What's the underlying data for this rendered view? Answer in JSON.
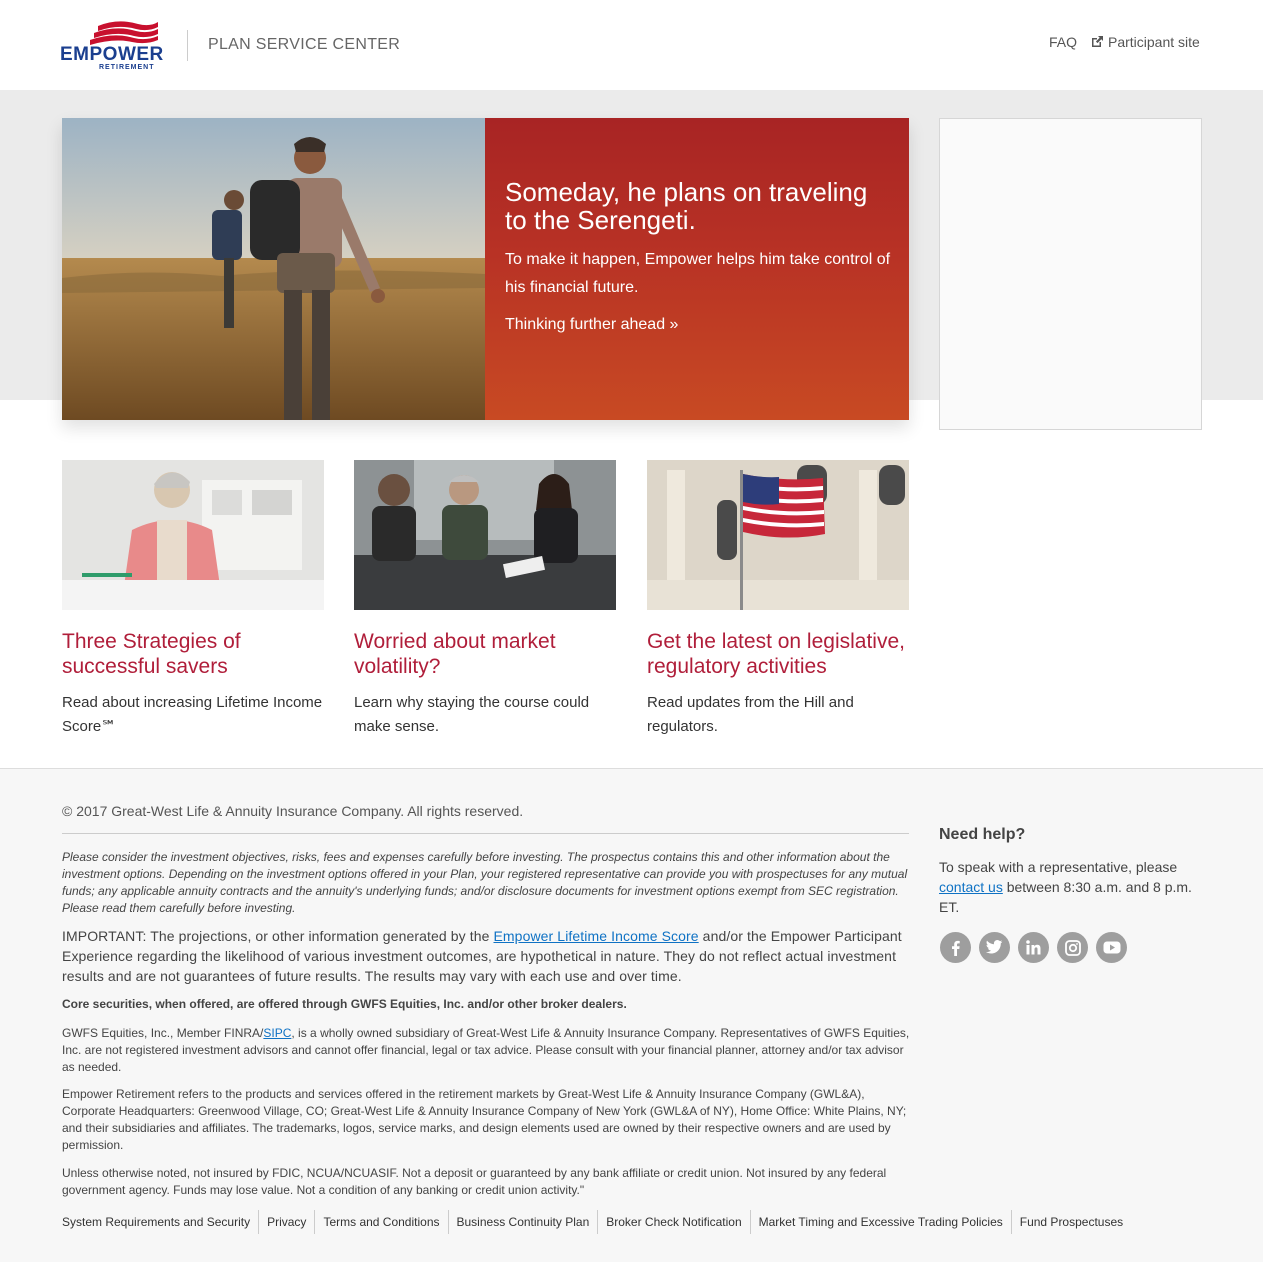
{
  "header": {
    "logo_word": "EMPOWER",
    "logo_sub": "RETIREMENT",
    "plan_title": "PLAN SERVICE CENTER",
    "faq_label": "FAQ",
    "participant_label": "Participant site"
  },
  "hero": {
    "title": "Someday, he plans on traveling to the Serengeti.",
    "text": "To make it happen, Empower helps him take control of his financial future.",
    "link": "Thinking further ahead »"
  },
  "cards": [
    {
      "title": "Three Strategies of successful savers",
      "desc": "Read about increasing Lifetime Income Score℠"
    },
    {
      "title": "Worried about market volatility?",
      "desc": "Learn why staying the course could make sense."
    },
    {
      "title": "Get the latest on legislative, regulatory activities",
      "desc": "Read updates from the Hill and regulators."
    }
  ],
  "footer": {
    "copyright": "© 2017 Great-West Life & Annuity Insurance Company. All rights reserved.",
    "disclaimer_italic": "Please consider the investment objectives, risks, fees and expenses carefully before investing. The prospectus contains this and other information about the investment options. Depending on the investment options offered in your Plan, your registered representative can provide you with prospectuses for any mutual funds; any applicable annuity contracts and the annuity's underlying funds; and/or disclosure documents for investment options exempt from SEC registration. Please read them carefully before investing.",
    "important_pre": "IMPORTANT: The projections, or other information generated by the ",
    "important_link": "Empower Lifetime Income Score",
    "important_post": " and/or the Empower Participant Experience regarding the likelihood of various investment outcomes, are hypothetical in nature. They do not reflect actual investment results and are not guarantees of future results. The results may vary with each use and over time.",
    "core_securities": "Core securities, when offered, are offered through GWFS Equities, Inc. and/or other broker dealers.",
    "gwfs_pre": "GWFS Equities, Inc., Member FINRA/",
    "gwfs_link": "SIPC",
    "gwfs_post": ", is a wholly owned subsidiary of Great-West Life & Annuity Insurance Company. Representatives of GWFS Equities, Inc. are not registered investment advisors and cannot offer financial, legal or tax advice. Please consult with your financial planner, attorney and/or tax advisor as needed.",
    "empower_refers": "Empower Retirement refers to the products and services offered in the retirement markets by Great-West Life & Annuity Insurance Company (GWL&A), Corporate Headquarters: Greenwood Village, CO; Great-West Life & Annuity Insurance Company of New York (GWL&A of NY), Home Office: White Plains, NY; and their subsidiaries and affiliates. The trademarks, logos, service marks, and design elements used are owned by their respective owners and are used by permission.",
    "not_insured": "Unless otherwise noted, not insured by FDIC, NCUA/NCUASIF. Not a deposit or guaranteed by any bank affiliate or credit union. Not insured by any federal government agency. Funds may lose value. Not a condition of any banking or credit union activity.\"",
    "links": [
      "System Requirements and Security",
      "Privacy",
      "Terms and Conditions",
      "Business Continuity Plan",
      "Broker Check Notification",
      "Market Timing and Excessive Trading Policies",
      "Fund Prospectuses"
    ]
  },
  "help": {
    "title": "Need help?",
    "text_pre": "To speak with a representative, please ",
    "contact_link": "contact us",
    "text_post": " between 8:30 a.m. and 8 p.m. ET.",
    "social": [
      "facebook-icon",
      "twitter-icon",
      "linkedin-icon",
      "instagram-icon",
      "youtube-icon"
    ]
  },
  "colors": {
    "brand_blue": "#1b3f8f",
    "brand_red": "#b01e3a",
    "hero_red": "#a82424",
    "link_blue": "#0f72c4"
  }
}
